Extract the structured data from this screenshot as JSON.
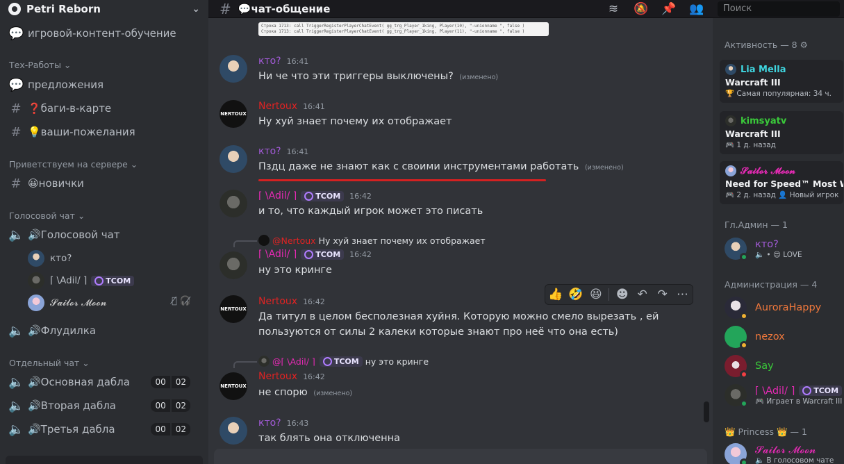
{
  "server": {
    "name": "Petri Reborn"
  },
  "sidebar": {
    "top_channel": "игровой-контент-обучение",
    "categories": [
      {
        "label": "Тех-Работы ⌄"
      },
      {
        "label": "Приветствуем на сервере ⌄"
      },
      {
        "label": "Голосовой чат ⌄"
      },
      {
        "label": "Отдельный чат ⌄"
      }
    ],
    "channels": [
      {
        "label": "предложения"
      },
      {
        "label": "❓баги-в-карте"
      },
      {
        "label": "💡ваши-пожелания"
      },
      {
        "label": "😀новички"
      },
      {
        "label": "🔊Голосовой чат"
      },
      {
        "label": "🔊Флудилка"
      },
      {
        "label": "🔊Основная дабла",
        "counts": [
          "00",
          "02"
        ]
      },
      {
        "label": "🔊Вторая дабла",
        "counts": [
          "00",
          "02"
        ]
      },
      {
        "label": "🔊Третья дабла",
        "counts": [
          "00",
          "02"
        ]
      }
    ],
    "voice_users": [
      {
        "name": "кто?"
      },
      {
        "name": "⌈ \\Adil/ ⌉",
        "tag": "TCOM"
      },
      {
        "name": "𝓢𝓪𝓲𝓵𝓸𝓻 𝓜𝓸𝓸𝓷"
      }
    ]
  },
  "topbar": {
    "channel": "💬чат-общение",
    "search_placeholder": "Поиск"
  },
  "code_snippet": [
    "Строка 1713:      call TriggerRegisterPlayerChatEvent( gg_trg_Player_1king, Player(10), \"-unionname \", false )",
    "Строка 1713:      call TriggerRegisterPlayerChatEvent( gg_trg_Player_1king, Player(11), \"-unionname \", false )"
  ],
  "messages": [
    {
      "author": "кто?",
      "time": "16:41",
      "text": "Ни че что эти триггеры выключены?",
      "edited": "(изменено)"
    },
    {
      "author": "Nertoux",
      "time": "16:41",
      "text": "Ну хуй знает почему их отображает"
    },
    {
      "author": "кто?",
      "time": "16:41",
      "text": "Пздц даже не знают как с своими инструментами работать",
      "edited": "(изменено)"
    },
    {
      "author": "⌈ \\Adil/ ⌉",
      "tag": "TCOM",
      "time": "16:42",
      "text": "и то, что каждый игрок может это писать"
    },
    {
      "reply_author": "@Nertoux",
      "reply_text": "Ну хуй знает почему их отображает",
      "author": "⌈ \\Adil/ ⌉",
      "tag": "TCOM",
      "time": "16:42",
      "text": "ну это кринге"
    },
    {
      "author": "Nertoux",
      "time": "16:42",
      "text": "Да титул в целом бесполезная хуйня. Которую можно смело вырезать , ей пользуются от силы 2 калеки которые знают про неё что она есть)"
    },
    {
      "reply_author": "@⌈ \\Adil/ ⌉",
      "reply_tag": "TCOM",
      "reply_text": "ну это кринге",
      "author": "Nertoux",
      "time": "16:42",
      "text": "не спорю",
      "edited": "(изменено)"
    },
    {
      "author": "кто?",
      "time": "16:43",
      "text": "так блять она отключенна"
    }
  ],
  "nertoux_avatar_text": "NERTOUX",
  "reactions": [
    "👍",
    "🤣",
    "😆"
  ],
  "members": {
    "activity_header": "Активность — 8 ⚙",
    "activities": [
      {
        "name": "Lia Mella",
        "game": "Warcraft III",
        "sub": "🏆 Самая популярная: 34 ч."
      },
      {
        "name": "kimsyatv",
        "game": "Warcraft III",
        "sub": "🎮 1 д. назад"
      },
      {
        "name": "𝓢𝓪𝓲𝓵𝓸𝓻 𝓜𝓸𝓸𝓷",
        "game": "Need for Speed™ Most Wanted",
        "sub": "🎮 2 д. назад  👤 Новый игрок"
      }
    ],
    "groups": [
      {
        "header": "Гл.Админ — 1"
      },
      {
        "header": "Администрация — 4"
      },
      {
        "header": "👑 Princess 👑 — 1"
      }
    ],
    "list": [
      {
        "name": "кто?",
        "sub": "🔈 • 😍 LOVE",
        "color": "#a35bd8"
      },
      {
        "name": "AuroraHappy",
        "color": "#f0783c"
      },
      {
        "name": "nezox",
        "color": "#f0783c"
      },
      {
        "name": "Say",
        "color": "#3ac93a"
      },
      {
        "name": "⌈ \\Adil/ ⌉",
        "tag": "TCOM",
        "sub": "🎮 Играет в Warcraft III",
        "color": "#e52ab4"
      },
      {
        "name": "𝓢𝓪𝓲𝓵𝓸𝓻 𝓜𝓸𝓸𝓷",
        "sub": "🔈 В голосовом чате",
        "color": "#e52ab4"
      }
    ]
  }
}
